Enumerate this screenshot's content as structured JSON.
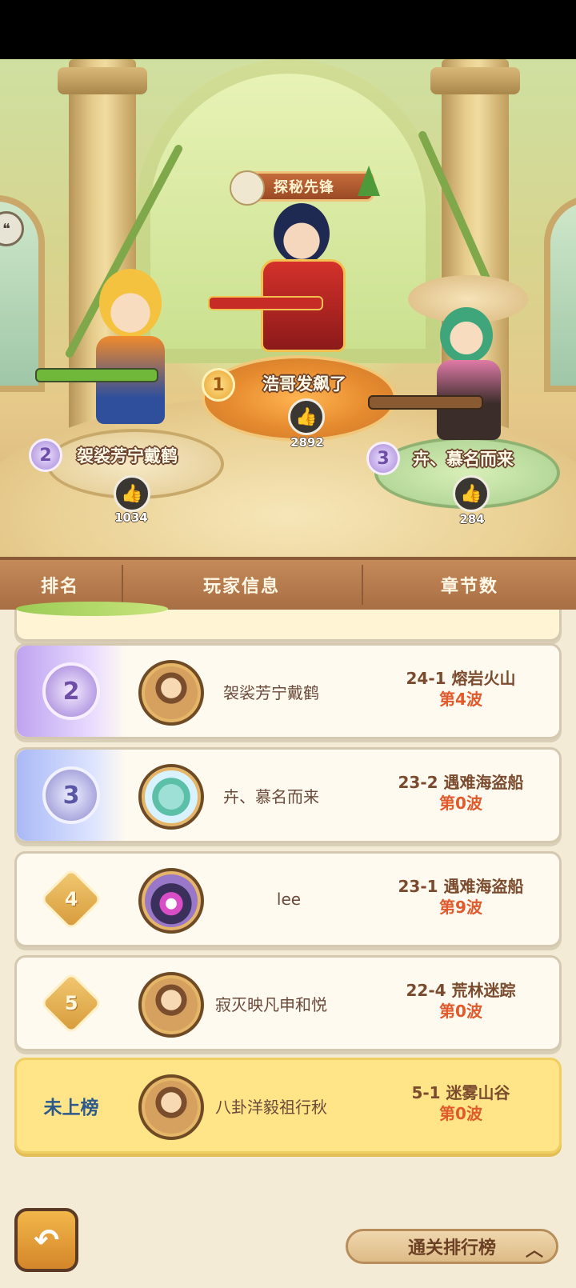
{
  "podium": {
    "title_badge": "探秘先锋",
    "first": {
      "rank": "1",
      "name": "浩哥发飙了",
      "likes": "2892"
    },
    "second": {
      "rank": "2",
      "name": "袈裟芳宁戴鹤",
      "likes": "1034"
    },
    "third": {
      "rank": "3",
      "name": "卉、慕名而来",
      "likes": "284"
    }
  },
  "table_header": {
    "rank": "排名",
    "player_info": "玩家信息",
    "chapters": "章节数"
  },
  "rows": [
    {
      "rank": "2",
      "name": "袈裟芳宁戴鹤",
      "chapter": "24-1 熔岩火山",
      "wave": "第4波"
    },
    {
      "rank": "3",
      "name": "卉、慕名而来",
      "chapter": "23-2 遇难海盗船",
      "wave": "第0波"
    },
    {
      "rank": "4",
      "name": "lee",
      "chapter": "23-1 遇难海盗船",
      "wave": "第9波"
    },
    {
      "rank": "5",
      "name": "寂灭映凡申和悦",
      "chapter": "22-4 荒林迷踪",
      "wave": "第0波"
    }
  ],
  "my_row": {
    "rank_text": "未上榜",
    "name": "八卦洋毅祖行秋",
    "chapter": "5-1 迷雾山谷",
    "wave": "第0波"
  },
  "footer": {
    "back_icon": "back-arrow-icon",
    "switch_label": "通关排行榜",
    "switch_icon": "chevron-up-icon"
  }
}
